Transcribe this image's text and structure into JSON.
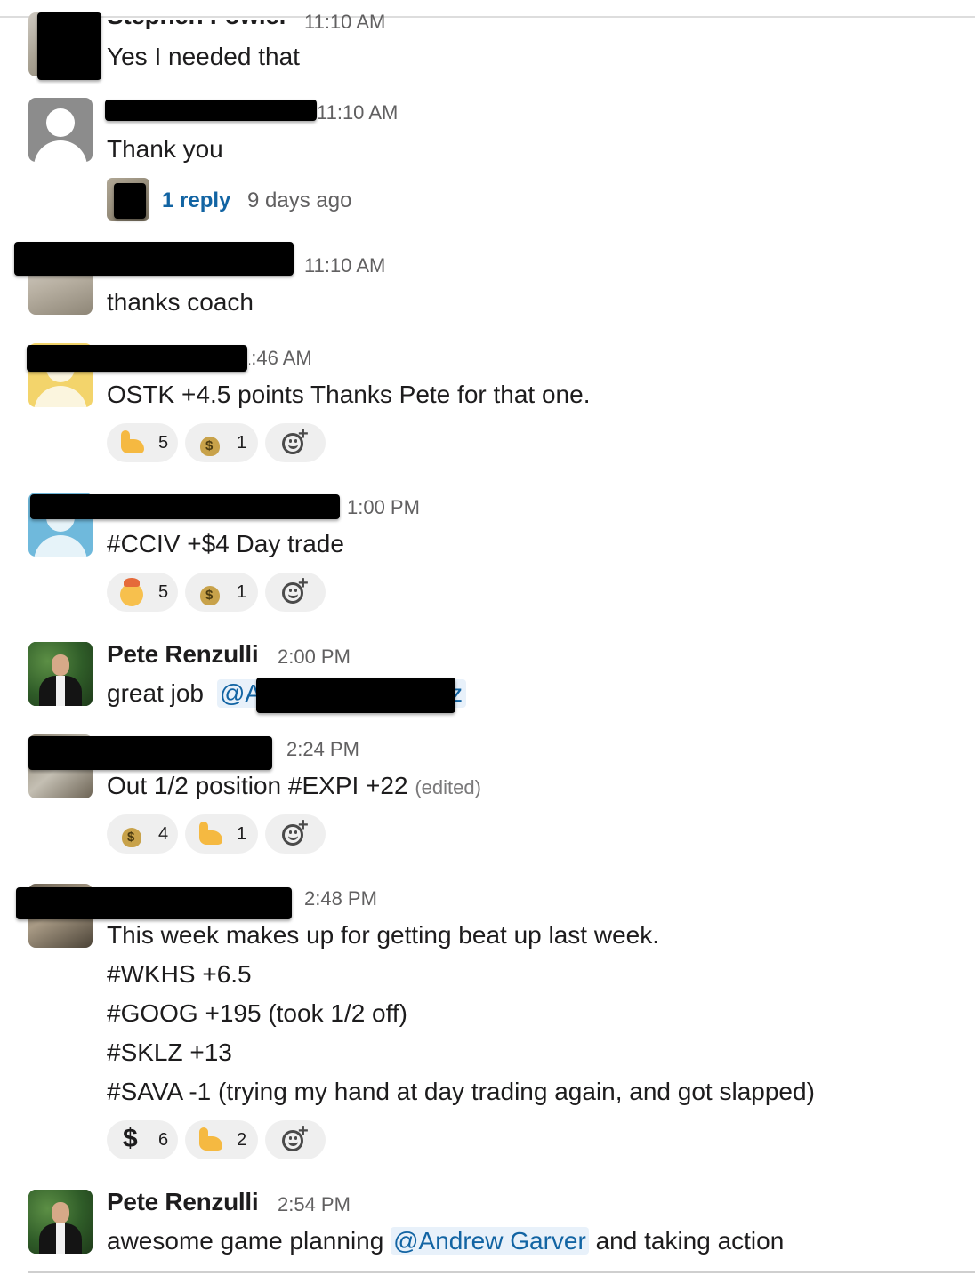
{
  "messages": [
    {
      "id": "m1",
      "name": "Stephen Fowler",
      "time": "11:10 AM",
      "lines": [
        "Yes I needed that"
      ]
    },
    {
      "id": "m2",
      "time": "11:10 AM",
      "lines": [
        "Thank you"
      ],
      "thread": {
        "reply_label": "1 reply",
        "meta": "9 days ago"
      }
    },
    {
      "id": "m3",
      "time": "11:10 AM",
      "lines": [
        "thanks coach"
      ]
    },
    {
      "id": "m4",
      "time": "1:46 AM",
      "lines": [
        "OSTK +4.5 points Thanks Pete for that one."
      ],
      "reactions": [
        {
          "icon": "flexed-biceps-icon",
          "count": "5"
        },
        {
          "icon": "money-bag-icon",
          "count": "1"
        }
      ]
    },
    {
      "id": "m5",
      "time": "1:00 PM",
      "lines": [
        "#CCIV +$4 Day trade"
      ],
      "reactions": [
        {
          "icon": "exploding-head-icon",
          "count": "5"
        },
        {
          "icon": "money-bag-icon",
          "count": "1"
        }
      ]
    },
    {
      "id": "m6",
      "name": "Pete Renzulli",
      "time": "2:00 PM",
      "text_prefix": "great job ",
      "mention": "@A",
      "mention_tail": "z"
    },
    {
      "id": "m7",
      "time": "2:24 PM",
      "text": "Out 1/2 position #EXPI +22",
      "edited": "(edited)",
      "reactions": [
        {
          "icon": "money-bag-icon",
          "count": "4"
        },
        {
          "icon": "flexed-biceps-icon",
          "count": "1"
        }
      ]
    },
    {
      "id": "m8",
      "time": "2:48 PM",
      "lines": [
        "This week makes up for getting beat up last week.",
        "#WKHS +6.5",
        "#GOOG +195 (took 1/2 off)",
        "#SKLZ +13",
        "#SAVA -1 (trying my hand at day trading again, and got slapped)"
      ],
      "reactions": [
        {
          "icon": "heavy-dollar-sign-icon",
          "count": "6"
        },
        {
          "icon": "flexed-biceps-icon",
          "count": "2"
        }
      ]
    },
    {
      "id": "m9",
      "name": "Pete Renzulli",
      "time": "2:54 PM",
      "text_prefix": "awesome game planning ",
      "mention": "@Andrew Garver",
      "text_suffix": " and taking action"
    }
  ],
  "icons": {
    "add_reaction": "add-reaction-icon"
  },
  "colors": {
    "link": "#1264a3",
    "mention_bg": "#e8f1fa",
    "reaction_bg": "#efefef"
  }
}
